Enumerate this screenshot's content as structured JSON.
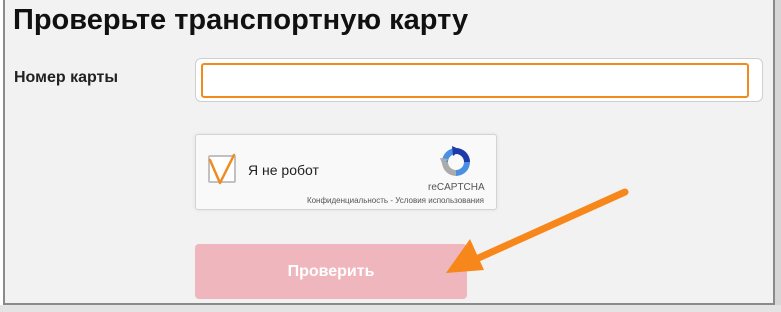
{
  "page": {
    "title": "Проверьте транспортную карту"
  },
  "form": {
    "card_number_label": "Номер карты",
    "card_number_value": "",
    "card_number_placeholder": ""
  },
  "recaptcha": {
    "checkbox_label": "Я не робот",
    "brand": "reCAPTCHA",
    "privacy_link": "Конфиденциальность",
    "separator": " - ",
    "terms_link": "Условия использования",
    "checked": true
  },
  "submit": {
    "label": "Проверить",
    "enabled": false
  },
  "colors": {
    "accent_orange": "#f08c1e",
    "button_disabled": "#efb6bd",
    "panel_bg": "#f2f2f2"
  },
  "annotations": {
    "arrow_icon": "arrow-pointing-to-submit"
  }
}
